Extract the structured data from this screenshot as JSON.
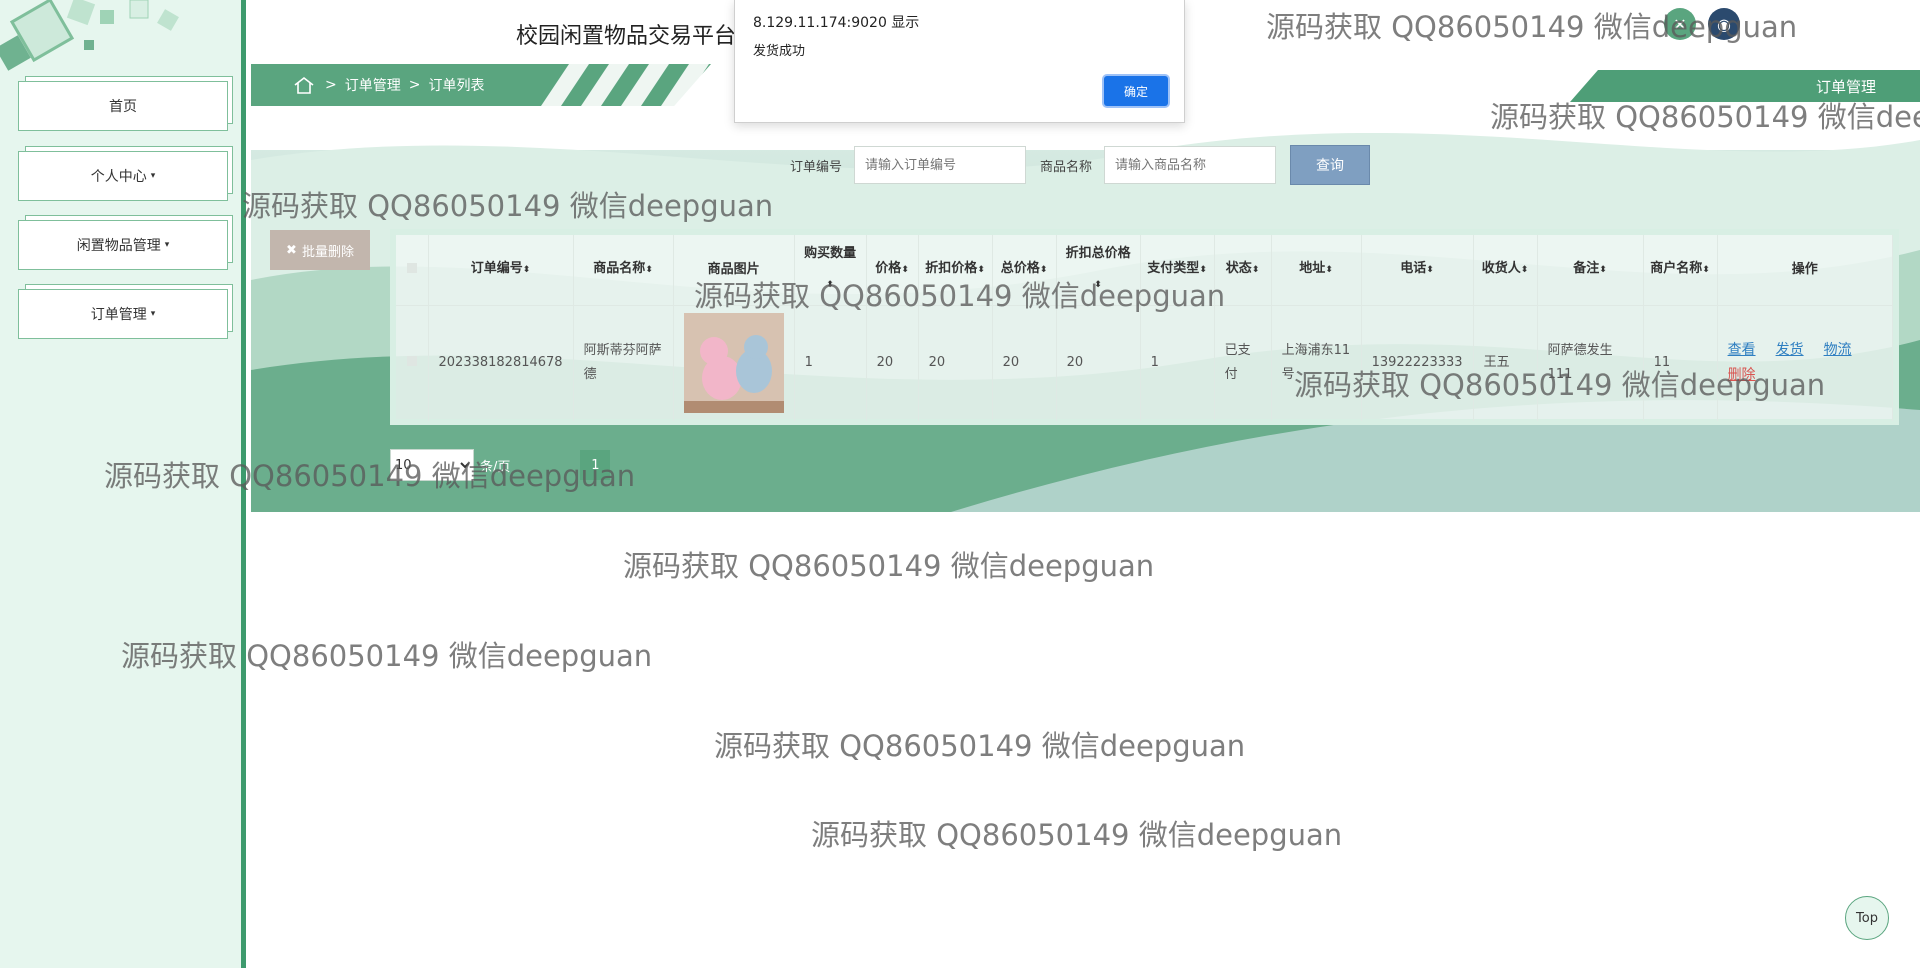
{
  "sidebar": {
    "items": [
      {
        "label": "首页",
        "has_caret": false
      },
      {
        "label": "个人中心",
        "has_caret": true
      },
      {
        "label": "闲置物品管理",
        "has_caret": true
      },
      {
        "label": "订单管理",
        "has_caret": true
      }
    ],
    "caret": "▾"
  },
  "header": {
    "site_title": "校园闲置物品交易平台",
    "breadcrumb": [
      ">",
      "订单管理",
      ">",
      "订单列表"
    ],
    "right_tab": "订单管理",
    "icons": [
      "close-icon",
      "user-icon"
    ]
  },
  "search": {
    "order_no_label": "订单编号",
    "order_no_placeholder": "请输入订单编号",
    "goods_name_label": "商品名称",
    "goods_name_placeholder": "请输入商品名称",
    "query_label": "查询"
  },
  "batch_delete": {
    "icon": "✖",
    "label": "批量删除"
  },
  "table": {
    "columns": [
      "订单编号",
      "商品名称",
      "商品图片",
      "购买数量",
      "价格",
      "折扣价格",
      "总价格",
      "折扣总价格",
      "支付类型",
      "状态",
      "地址",
      "电话",
      "收货人",
      "备注",
      "商户名称",
      "操作"
    ],
    "rows": [
      {
        "order_no": "202338182814678",
        "goods_name": "阿斯蒂芬阿萨德",
        "quantity": "1",
        "price": "20",
        "discount_price": "20",
        "total": "20",
        "discount_total": "20",
        "pay_type": "1",
        "status": "已支付",
        "address": "上海浦东11号",
        "phone": "13922223333",
        "receiver": "王五",
        "note": "阿萨德发生111",
        "merchant": "11",
        "actions": [
          "查看",
          "发货",
          "物流",
          "删除"
        ]
      }
    ]
  },
  "pager": {
    "page_size": "10",
    "suffix": "条/页",
    "current_page": "1"
  },
  "alert": {
    "origin": "8.129.11.174:9020 显示",
    "message": "发货成功",
    "ok_label": "确定"
  },
  "top_button": "Top",
  "watermark": "源码获取 QQ86050149 微信deepguan",
  "colors": {
    "brand_green": "#3d9a6d",
    "query_blue": "#7f9fc1",
    "ok_blue": "#1a73e8",
    "link_blue": "#2f7fc1",
    "delete_red": "#d9534f"
  }
}
